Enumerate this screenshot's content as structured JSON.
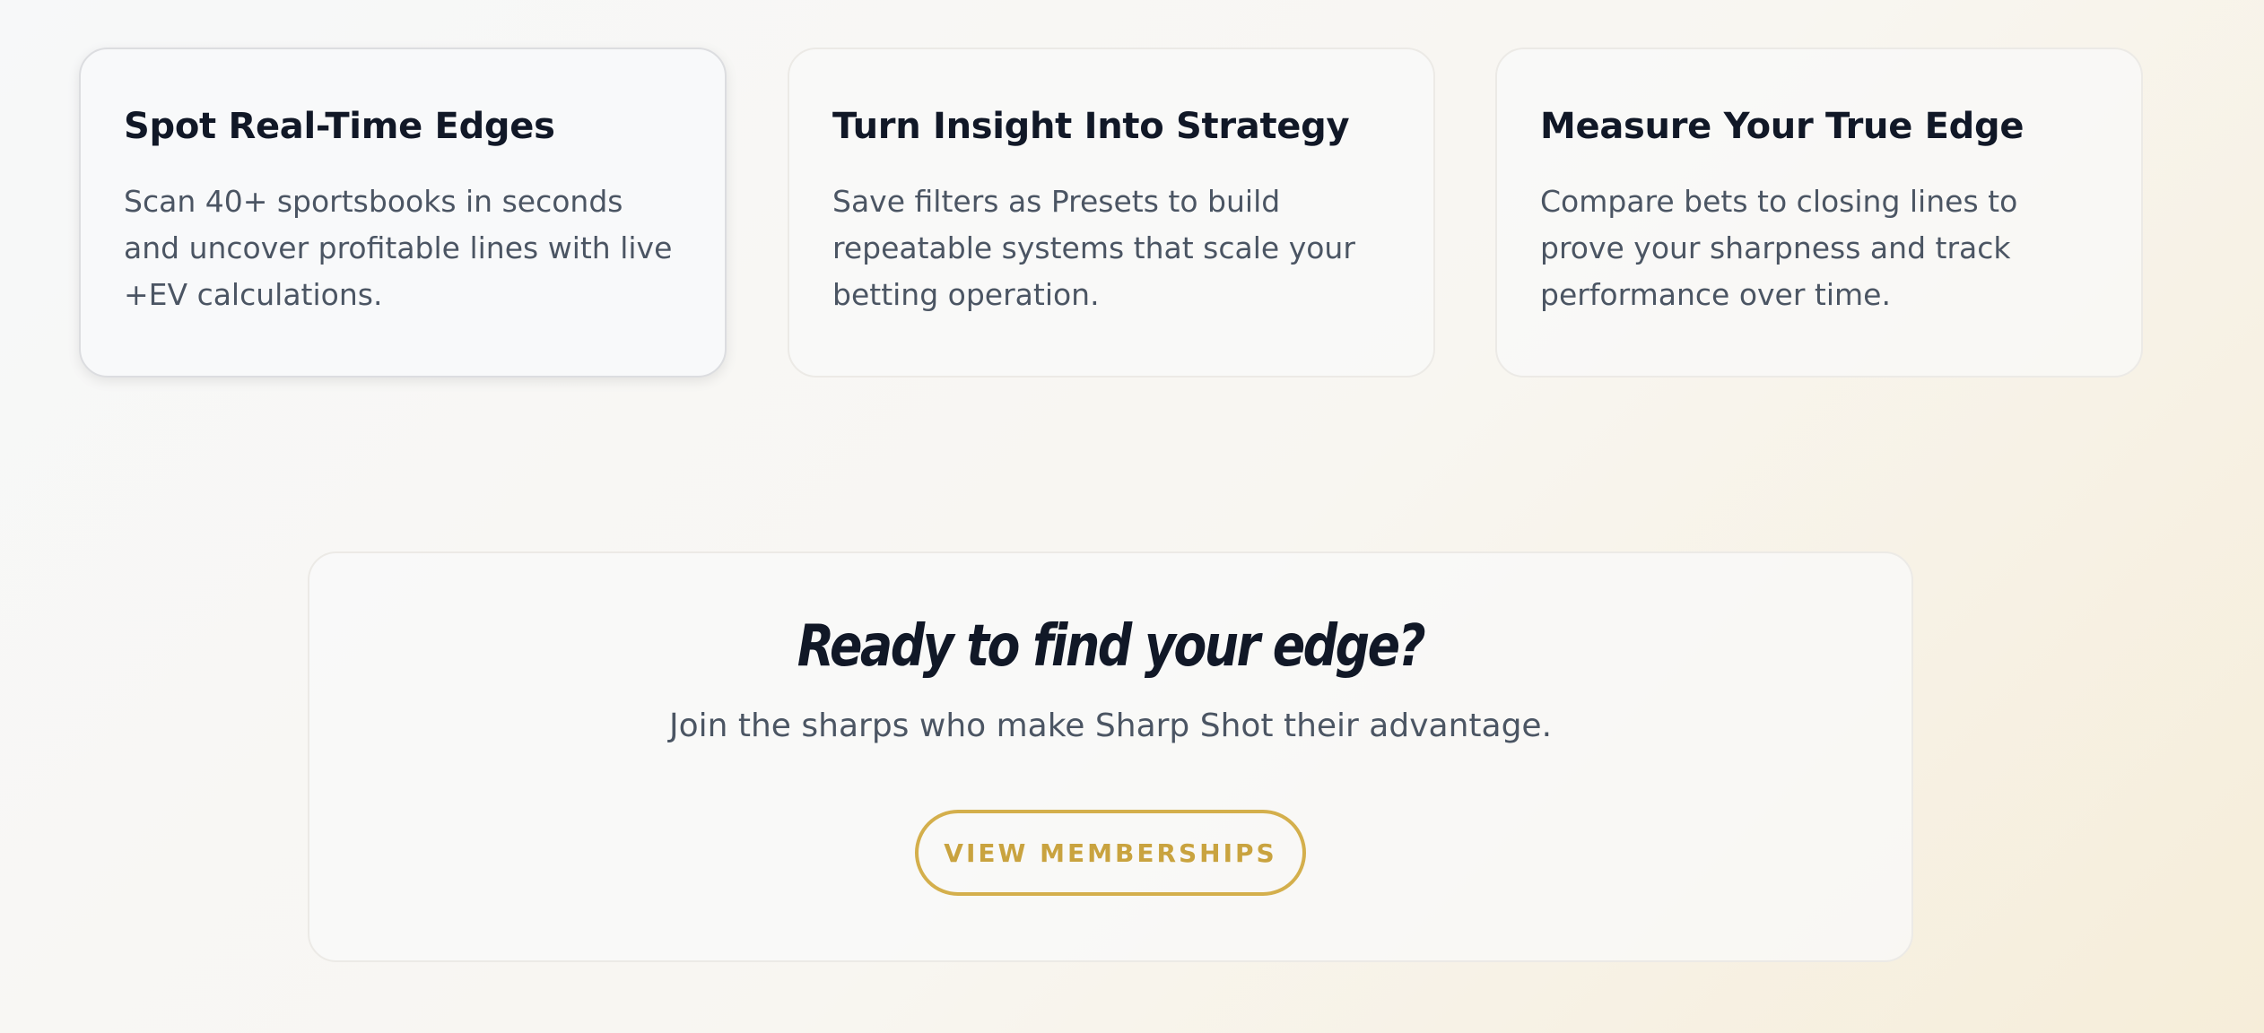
{
  "features": [
    {
      "title": "Spot Real-Time Edges",
      "body": "Scan 40+ sportsbooks in seconds and uncover profitable lines with live +EV calculations."
    },
    {
      "title": "Turn Insight Into Strategy",
      "body": "Save filters as Presets to build repeatable systems that scale your betting operation."
    },
    {
      "title": "Measure Your True Edge",
      "body": "Compare bets to closing lines to prove your sharpness and track performance over time."
    }
  ],
  "cta": {
    "title": "Ready to find your edge?",
    "subtitle": "Join the sharps who make Sharp Shot their advantage.",
    "button_label": "VIEW MEMBERSHIPS"
  },
  "colors": {
    "accent_gold": "#d4af4c",
    "heading": "#111827",
    "body_text": "#4b5563"
  }
}
